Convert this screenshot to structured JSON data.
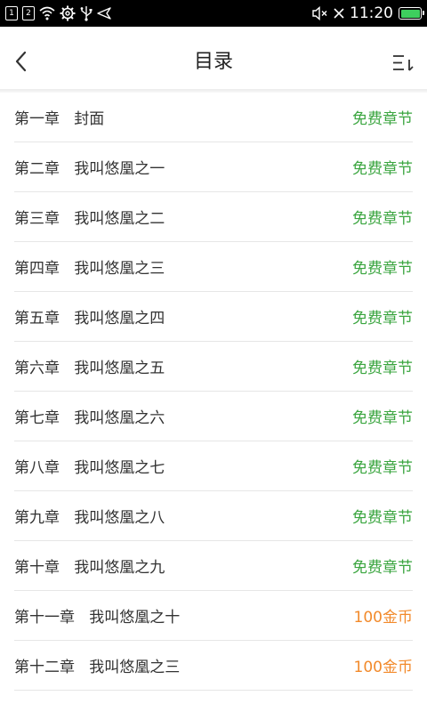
{
  "status_bar": {
    "sim1": "1",
    "sim2": "2",
    "time": "11:20",
    "icons": [
      "sim1-icon",
      "sim2-icon",
      "wifi-icon",
      "settings-icon",
      "usb-icon",
      "navigation-icon",
      "mute-icon",
      "no-signal-icon",
      "battery-icon"
    ],
    "battery_color": "#3ecf5e"
  },
  "header": {
    "title": "目录",
    "back_icon": "chevron-left-icon",
    "sort_icon": "sort-icon"
  },
  "colors": {
    "free": "#3aa53f",
    "paid": "#f28a2b"
  },
  "chapters": [
    {
      "title": "第一章   封面",
      "tag": "免费章节",
      "type": "free"
    },
    {
      "title": "第二章   我叫悠凰之一",
      "tag": "免费章节",
      "type": "free"
    },
    {
      "title": "第三章   我叫悠凰之二",
      "tag": "免费章节",
      "type": "free"
    },
    {
      "title": "第四章   我叫悠凰之三",
      "tag": "免费章节",
      "type": "free"
    },
    {
      "title": "第五章   我叫悠凰之四",
      "tag": "免费章节",
      "type": "free"
    },
    {
      "title": "第六章   我叫悠凰之五",
      "tag": "免费章节",
      "type": "free"
    },
    {
      "title": "第七章   我叫悠凰之六",
      "tag": "免费章节",
      "type": "free"
    },
    {
      "title": "第八章   我叫悠凰之七",
      "tag": "免费章节",
      "type": "free"
    },
    {
      "title": "第九章   我叫悠凰之八",
      "tag": "免费章节",
      "type": "free"
    },
    {
      "title": "第十章   我叫悠凰之九",
      "tag": "免费章节",
      "type": "free"
    },
    {
      "title": "第十一章   我叫悠凰之十",
      "tag": "100金币",
      "type": "paid"
    },
    {
      "title": "第十二章   我叫悠凰之三",
      "tag": "100金币",
      "type": "paid"
    }
  ]
}
